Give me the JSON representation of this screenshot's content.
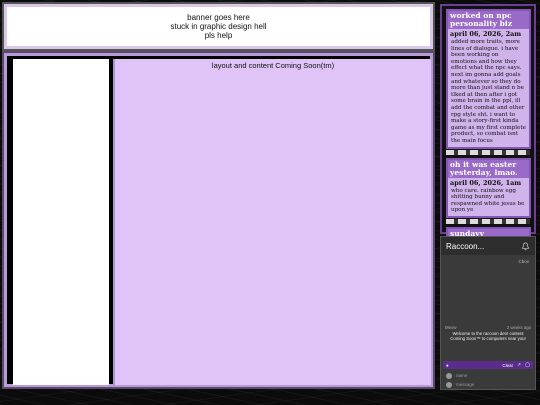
{
  "banner": {
    "line1": "banner goes here",
    "line2": "stuck in graphic design hell",
    "line3": "pls help"
  },
  "content": {
    "text": "layout and content Coming Soon(tm)"
  },
  "posts": [
    {
      "title": "worked on npc personality biz",
      "date": "april 06, 2026, 2am",
      "body": "added more traits, more lines of dialogue. i have been working on emotions and how they effect what the npc says. next im gonna add goals and whatever so they do more than just stand n be tlked at then after i got some brain in the ppl, ill add the combat and other rpg style sht. i want to make a story-first kinda game as my first complete product, so combat isnt the main focus"
    },
    {
      "title": "oh it was easter yesterday, lmao.",
      "date": "april 06, 2026, 1am",
      "body": "who care. rainbow egg shitting bunny and respawned white jesus be upon ye"
    },
    {
      "title": "sundayy",
      "date": "",
      "body": ""
    }
  ],
  "chat": {
    "title": "Raccoon...",
    "brand": "Cbox",
    "message": {
      "author": "Meow",
      "time": "2 weeks ago",
      "text": "Welcome to the raccoon den! content Coming Soon™ to computers near you!"
    },
    "bar": {
      "clear_label": "Clear"
    },
    "name_placeholder": "name",
    "message_placeholder": "message"
  },
  "colors": {
    "accent": "#9a6ac8",
    "content_bg": "#e0c4f7",
    "chat_bar": "#5a2d8c"
  }
}
